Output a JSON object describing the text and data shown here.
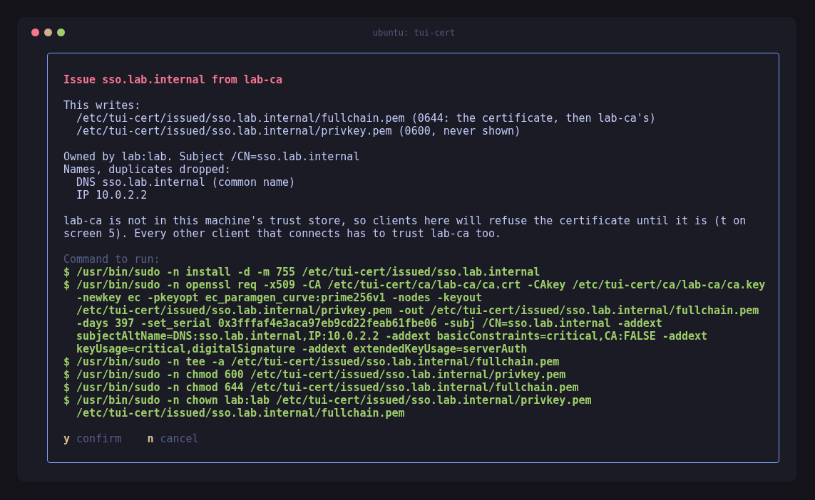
{
  "window": {
    "title": "ubuntu: tui-cert"
  },
  "dialog": {
    "title": "Issue sso.lab.internal from lab-ca",
    "writes": {
      "heading": "This writes:",
      "files": [
        "/etc/tui-cert/issued/sso.lab.internal/fullchain.pem (0644: the certificate, then lab-ca's)",
        "/etc/tui-cert/issued/sso.lab.internal/privkey.pem (0600, never shown)"
      ]
    },
    "subject": "Owned by lab:lab. Subject /CN=sso.lab.internal",
    "names": {
      "heading": "Names, duplicates dropped:",
      "entries": [
        "DNS sso.lab.internal (common name)",
        "IP 10.0.2.2"
      ]
    },
    "trust_note": "lab-ca is not in this machine's trust store, so clients here will refuse the certificate until it is (t on screen 5). Every other client that connects has to trust lab-ca too.",
    "command": {
      "heading": "Command to run:",
      "commands": [
        {
          "lines": [
            "$ /usr/bin/sudo -n install -d -m 755 /etc/tui-cert/issued/sso.lab.internal"
          ]
        },
        {
          "lines": [
            "$ /usr/bin/sudo -n openssl req -x509 -CA /etc/tui-cert/ca/lab-ca/ca.crt -CAkey /etc/tui-cert/ca/lab-ca/ca.key",
            "-newkey ec -pkeyopt ec_paramgen_curve:prime256v1 -nodes -keyout",
            "/etc/tui-cert/issued/sso.lab.internal/privkey.pem -out /etc/tui-cert/issued/sso.lab.internal/fullchain.pem",
            "-days 397 -set_serial 0x3fffaf4e3aca97eb9cd22feab61fbe06 -subj /CN=sso.lab.internal -addext",
            "subjectAltName=DNS:sso.lab.internal,IP:10.0.2.2 -addext basicConstraints=critical,CA:FALSE -addext",
            "keyUsage=critical,digitalSignature -addext extendedKeyUsage=serverAuth"
          ]
        },
        {
          "lines": [
            "$ /usr/bin/sudo -n tee -a /etc/tui-cert/issued/sso.lab.internal/fullchain.pem"
          ]
        },
        {
          "lines": [
            "$ /usr/bin/sudo -n chmod 600 /etc/tui-cert/issued/sso.lab.internal/privkey.pem"
          ]
        },
        {
          "lines": [
            "$ /usr/bin/sudo -n chmod 644 /etc/tui-cert/issued/sso.lab.internal/fullchain.pem"
          ]
        },
        {
          "lines": [
            "$ /usr/bin/sudo -n chown lab:lab /etc/tui-cert/issued/sso.lab.internal/privkey.pem",
            "/etc/tui-cert/issued/sso.lab.internal/fullchain.pem"
          ]
        }
      ]
    },
    "keys": [
      {
        "key": "y",
        "label": "confirm"
      },
      {
        "key": "n",
        "label": "cancel"
      }
    ]
  }
}
